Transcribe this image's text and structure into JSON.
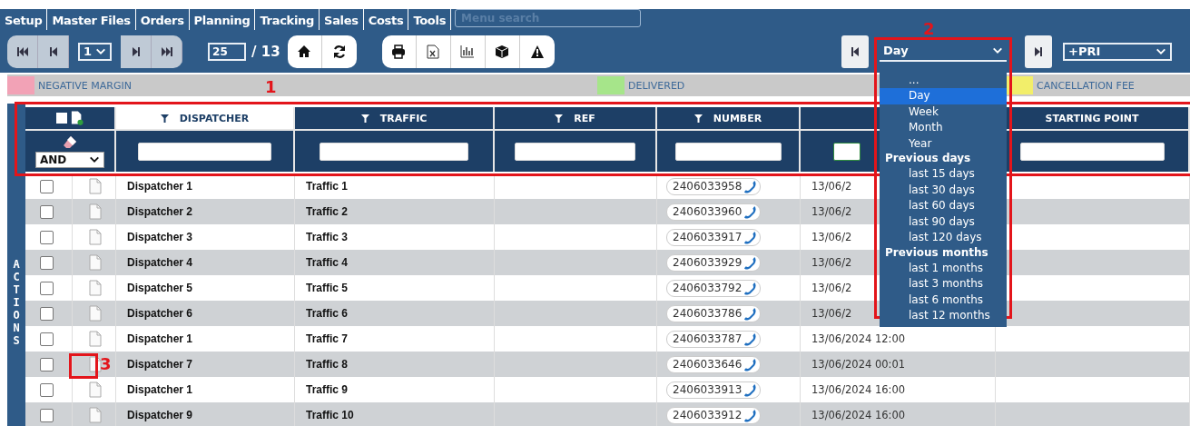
{
  "menu": {
    "items": [
      "Setup",
      "Master Files",
      "Orders",
      "Planning",
      "Tracking",
      "Sales",
      "Costs",
      "Tools"
    ],
    "search": {
      "placeholder": "Menu search"
    }
  },
  "toolbar": {
    "page_select": "1",
    "page_size": "25",
    "page_total": "/ 13",
    "priority_select": "+PRI",
    "period": {
      "value": "Day",
      "annotation": "2",
      "options": [
        {
          "label": "...",
          "kind": "option",
          "selected": false
        },
        {
          "label": "Day",
          "kind": "option",
          "selected": true
        },
        {
          "label": "Week",
          "kind": "option",
          "selected": false
        },
        {
          "label": "Month",
          "kind": "option",
          "selected": false
        },
        {
          "label": "Year",
          "kind": "option",
          "selected": false
        },
        {
          "label": "Previous days",
          "kind": "group"
        },
        {
          "label": "last 15 days",
          "kind": "option",
          "selected": false
        },
        {
          "label": "last 30 days",
          "kind": "option",
          "selected": false
        },
        {
          "label": "last 60 days",
          "kind": "option",
          "selected": false
        },
        {
          "label": "last 90 days",
          "kind": "option",
          "selected": false
        },
        {
          "label": "last 120 days",
          "kind": "option",
          "selected": false
        },
        {
          "label": "Previous months",
          "kind": "group"
        },
        {
          "label": "last 1 months",
          "kind": "option",
          "selected": false
        },
        {
          "label": "last 3 months",
          "kind": "option",
          "selected": false
        },
        {
          "label": "last 6 months",
          "kind": "option",
          "selected": false
        },
        {
          "label": "last 12 months",
          "kind": "option",
          "selected": false
        }
      ]
    }
  },
  "legend": [
    {
      "label": "NEGATIVE MARGIN",
      "color": "#f2a2b6"
    },
    {
      "label": "DELIVERED",
      "color": "#a6e58a"
    },
    {
      "label": "CANCELLATION FEE",
      "color": "#f2ee6a"
    }
  ],
  "table": {
    "annotation": "1",
    "side_label": "ACTIONS",
    "logic_select": "AND",
    "select_all_checked": false,
    "columns": [
      {
        "label": "DISPATCHER",
        "filter": true,
        "selected": true
      },
      {
        "label": "TRAFFIC",
        "filter": true,
        "selected": false
      },
      {
        "label": "REF",
        "filter": true,
        "selected": false
      },
      {
        "label": "NUMBER",
        "filter": true,
        "selected": false
      },
      {
        "selected": false
      },
      {
        "label": "STARTING POINT",
        "filter": false,
        "selected": false
      }
    ],
    "rows": [
      {
        "checked": false,
        "annotation": "",
        "dispatcher": "Dispatcher 1",
        "traffic": "Traffic 1",
        "number": "2406033958",
        "date": "13/06/2"
      },
      {
        "checked": false,
        "annotation": "",
        "dispatcher": "Dispatcher 2",
        "traffic": "Traffic 2",
        "number": "2406033960",
        "date": "13/06/2"
      },
      {
        "checked": false,
        "annotation": "",
        "dispatcher": "Dispatcher 3",
        "traffic": "Traffic 3",
        "number": "2406033917",
        "date": "13/06/2"
      },
      {
        "checked": false,
        "annotation": "",
        "dispatcher": "Dispatcher 4",
        "traffic": "Traffic 4",
        "number": "2406033929",
        "date": "13/06/2"
      },
      {
        "checked": false,
        "annotation": "",
        "dispatcher": "Dispatcher 5",
        "traffic": "Traffic 5",
        "number": "2406033792",
        "date": "13/06/2"
      },
      {
        "checked": false,
        "annotation": "",
        "dispatcher": "Dispatcher 6",
        "traffic": "Traffic 6",
        "number": "2406033786",
        "date": "13/06/2"
      },
      {
        "checked": false,
        "annotation": "",
        "dispatcher": "Dispatcher 1",
        "traffic": "Traffic 7",
        "number": "2406033787",
        "date": "13/06/2024 12:00"
      },
      {
        "checked": false,
        "annotation": "3",
        "dispatcher": "Dispatcher 7",
        "traffic": "Traffic 8",
        "number": "2406033646",
        "date": "13/06/2024 00:01"
      },
      {
        "checked": false,
        "annotation": "",
        "dispatcher": "Dispatcher 1",
        "traffic": "Traffic 9",
        "number": "2406033913",
        "date": "13/06/2024 16:00"
      },
      {
        "checked": false,
        "annotation": "",
        "dispatcher": "Dispatcher 9",
        "traffic": "Traffic 10",
        "number": "2406033912",
        "date": "13/06/2024 16:00"
      }
    ]
  }
}
